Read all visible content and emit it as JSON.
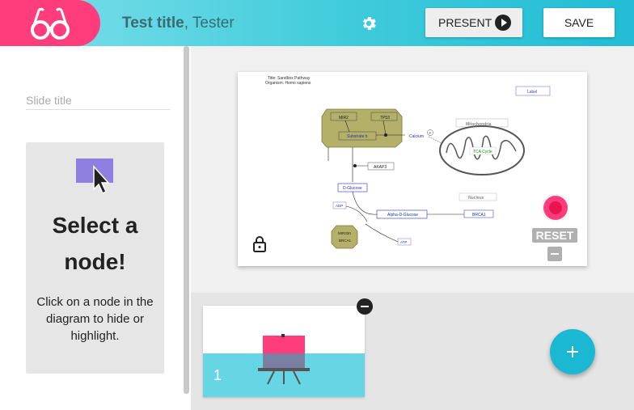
{
  "header": {
    "doc_title": "Test title",
    "doc_author": ", Tester",
    "present_label": "PRESENT",
    "save_label": "SAVE",
    "colors": {
      "logo_bg": "#ff3d7c",
      "header_gradient": "#3fcbdb"
    }
  },
  "left_panel": {
    "slide_title_placeholder": "Slide title",
    "select_heading": "Select a node!",
    "select_help": "Click on a node in the diagram to hide or highlight."
  },
  "diagram": {
    "header_line1": "Title: Sandbox Pathway",
    "header_line2": "Organism: Homo sapiens",
    "nodes": {
      "label": "Label",
      "mir2": "MIR2",
      "tp53": "TP53",
      "substrate": "Substrate b",
      "calcium": "Calcium",
      "p": "P",
      "mitochondria": "Mitochondria",
      "tca": "TCA Cycle",
      "akap3": "AKAP3",
      "dglucose": "D-Glucose",
      "nucleus": "Nucleus",
      "adp": "ADP",
      "alpha": "Alpha-D-Glucose",
      "brca1a": "BRCA1",
      "mir": "MIR330",
      "brca1b": "BRCA1",
      "atp": "ATP"
    },
    "reset_label": "RESET"
  },
  "slides": {
    "items": [
      {
        "number": "1"
      }
    ]
  }
}
